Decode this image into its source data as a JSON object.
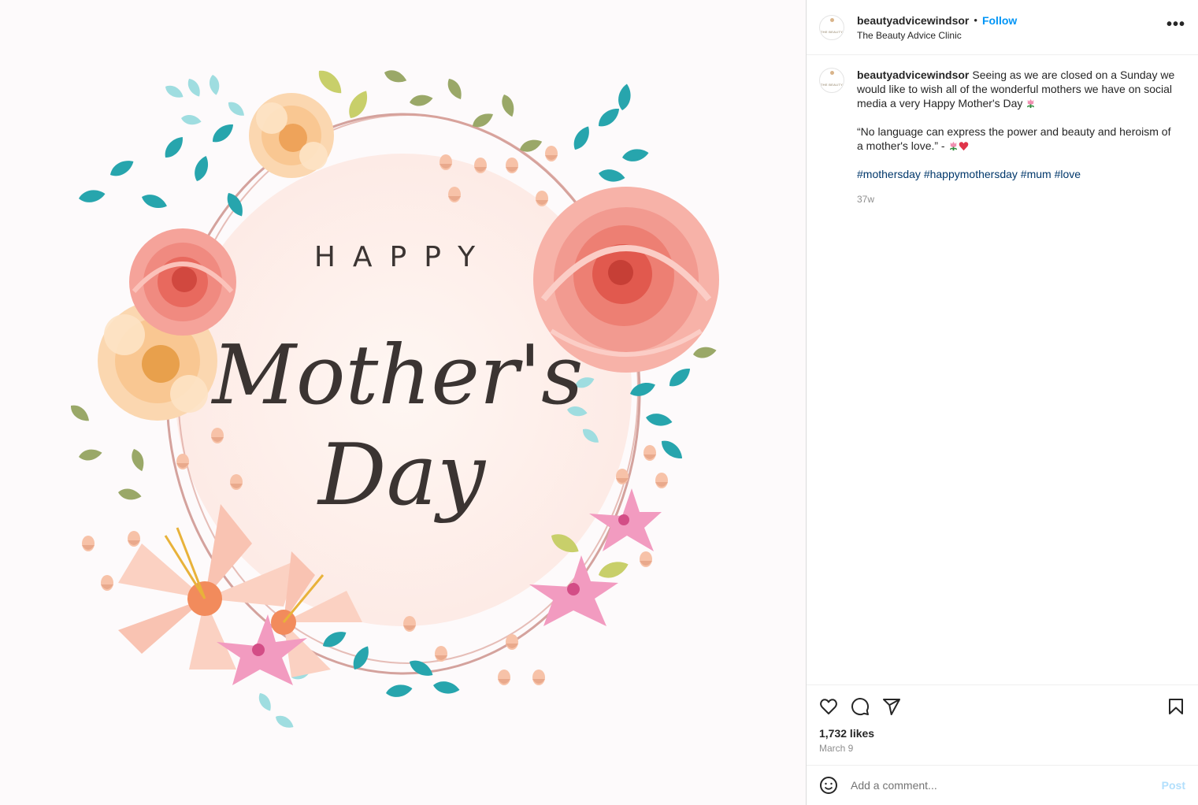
{
  "post": {
    "image_text": {
      "line1": "HAPPY",
      "line2": "Mother's",
      "line3": "Day"
    }
  },
  "header": {
    "username": "beautyadvicewindsor",
    "separator": "•",
    "follow_label": "Follow",
    "subtitle": "The Beauty Advice Clinic",
    "more_label": "•••",
    "avatar_text": "THE BEAUTY"
  },
  "caption": {
    "username": "beautyadvicewindsor",
    "text1": "Seeing as we are closed on a Sunday we would like to wish all of the wonderful mothers we have on social media a very Happy Mother's Day",
    "quote": "“No language can express the power and beauty and heroism of a mother's love.” -",
    "hashtags": "#mothersday #happymothersday #mum #love",
    "age": "37w"
  },
  "footer": {
    "likes": "1,732 likes",
    "date": "March 9",
    "comment_placeholder": "Add a comment...",
    "post_label": "Post"
  },
  "icons": {
    "like": "heart-icon",
    "comment": "comment-bubble-icon",
    "share": "paper-plane-icon",
    "save": "bookmark-icon",
    "emoji": "smiley-icon",
    "more": "more-dots-icon"
  },
  "colors": {
    "link_blue": "#0095f6",
    "hashtag_blue": "#00376b",
    "post_disabled": "#b2dffc",
    "rose": "#f08a80",
    "peach": "#fbd3a8",
    "teal_leaf": "#27a5ad"
  }
}
